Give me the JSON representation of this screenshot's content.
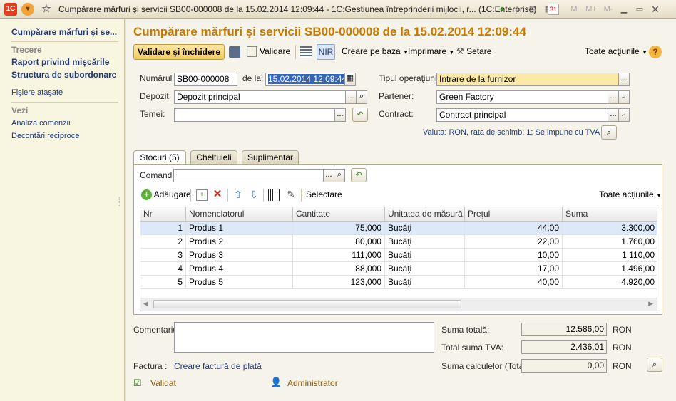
{
  "window": {
    "title": "Cumpărare mărfuri şi servicii SB00-000008 de la 15.02.2014 12:09:44 - 1C:Gestiunea întreprinderii mijlocii, r... (1C:Enterprise)",
    "app_badge": "1C",
    "calendar_day": "31",
    "memory_buttons": [
      "M",
      "M+",
      "M-"
    ]
  },
  "sidebar": {
    "top_link": "Cumpărare mărfuri şi se...",
    "sections": [
      {
        "heading": "Trecere",
        "items": [
          "Raport privind mişcările",
          "Structura de subordonare"
        ]
      },
      {
        "heading": "",
        "items": [
          "Fişiere ataşate"
        ]
      },
      {
        "heading": "Vezi",
        "items": [
          "Analiza comenzii",
          "Decontări reciproce"
        ]
      }
    ]
  },
  "document": {
    "title": "Cumpărare mărfuri şi servicii SB00-000008 de la 15.02.2014 12:09:44"
  },
  "toolbar": {
    "validate_close": "Validare şi închidere",
    "validate": "Validare",
    "nir": "NIR",
    "create_based": "Creare pe baza",
    "print": "Imprimare",
    "settings": "Setare",
    "all_actions": "Toate acţiunile",
    "help": "?"
  },
  "form": {
    "number_label": "Numărul :",
    "number_value": "SB00-000008",
    "date_label": "de la:",
    "date_value": "15.02.2014 12:09:44",
    "operation_label": "Tipul operaţiunii:",
    "operation_value": "Intrare de la furnizor",
    "warehouse_label": "Depozit:",
    "warehouse_value": "Depozit principal",
    "partner_label": "Partener:",
    "partner_value": "Green Factory",
    "basis_label": "Temei:",
    "basis_value": "",
    "contract_label": "Contract:",
    "contract_value": "Contract principal",
    "currency_info": "Valuta: RON, rata de schimb: 1; Se impune cu TVA",
    "ellipsis": "..."
  },
  "tabs": [
    {
      "label": "Stocuri  (5)",
      "active": true
    },
    {
      "label": "Cheltuieli",
      "active": false
    },
    {
      "label": "Suplimentar",
      "active": false
    }
  ],
  "stock_tab": {
    "order_label": "Comanda:",
    "order_value": "",
    "add": "Adăugare",
    "select": "Selectare",
    "all_actions": "Toate acţiunile"
  },
  "grid": {
    "columns": [
      "Nr",
      "Nomenclatorul",
      "Cantitate",
      "Unitatea de măsură",
      "Preţul",
      "Suma"
    ],
    "rows": [
      {
        "nr": "1",
        "item": "Produs 1",
        "qty": "75,000",
        "unit": "Bucăţi",
        "price": "44,00",
        "sum": "3.300,00"
      },
      {
        "nr": "2",
        "item": "Produs 2",
        "qty": "80,000",
        "unit": "Bucăţi",
        "price": "22,00",
        "sum": "1.760,00"
      },
      {
        "nr": "3",
        "item": "Produs 3",
        "qty": "111,000",
        "unit": "Bucăţi",
        "price": "10,00",
        "sum": "1.110,00"
      },
      {
        "nr": "4",
        "item": "Produs 4",
        "qty": "88,000",
        "unit": "Bucăţi",
        "price": "17,00",
        "sum": "1.496,00"
      },
      {
        "nr": "5",
        "item": "Produs 5",
        "qty": "123,000",
        "unit": "Bucăţi",
        "price": "40,00",
        "sum": "4.920,00"
      }
    ]
  },
  "footer": {
    "comment_label": "Comentariu:",
    "comment_value": "",
    "invoice_label": "Factura :",
    "invoice_link": "Creare factură de plată",
    "status": "Validat",
    "user": "Administrator",
    "totals": [
      {
        "label": "Suma totală:",
        "value": "12.586,00",
        "currency": "RON"
      },
      {
        "label": "Total suma TVA:",
        "value": "2.436,01",
        "currency": "RON"
      },
      {
        "label": "Suma calculelor (Total):",
        "value": "0,00",
        "currency": "RON"
      }
    ]
  },
  "colors": {
    "accent": "#c57a00",
    "link": "#1f3a7a",
    "selected_row": "#dde9f8",
    "highlight_field": "#fde9a6"
  }
}
